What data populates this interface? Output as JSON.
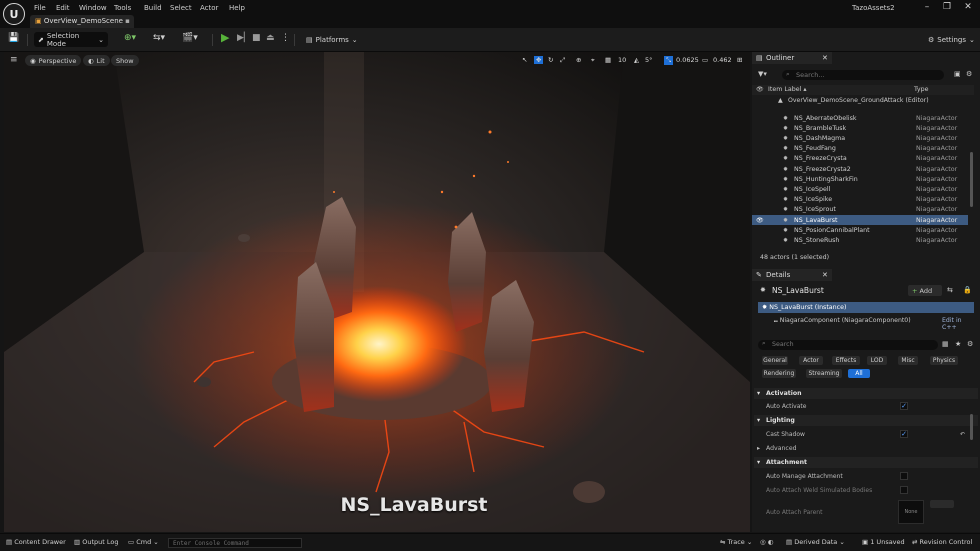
{
  "app": {
    "menu": [
      "File",
      "Edit",
      "Window",
      "Tools",
      "Build",
      "Select",
      "Actor",
      "Help"
    ],
    "document_tab": "OverView_DemoScene",
    "project_name": "TazoAssets2"
  },
  "toolbar": {
    "selection_mode": "Selection Mode",
    "platforms": "Platforms",
    "settings": "Settings"
  },
  "viewport": {
    "perspective": "Perspective",
    "lit": "Lit",
    "show": "Show",
    "grid_snap": "10",
    "rotation_snap": "5°",
    "scale_snap": "0.0625",
    "camera_speed": "0.462",
    "overlay_label": "NS_LavaBurst"
  },
  "outliner": {
    "tab": "Outliner",
    "search_placeholder": "Search...",
    "col_label": "Item Label ▴",
    "col_type": "Type",
    "level": "OverView_DemoScene_GroundAttack (Editor)",
    "rows": [
      {
        "name": "NS_AberrateObelisk",
        "type": "NiagaraActor"
      },
      {
        "name": "NS_BrambleTusk",
        "type": "NiagaraActor"
      },
      {
        "name": "NS_DashMagma",
        "type": "NiagaraActor"
      },
      {
        "name": "NS_FeudFang",
        "type": "NiagaraActor"
      },
      {
        "name": "NS_FreezeCrysta",
        "type": "NiagaraActor"
      },
      {
        "name": "NS_FreezeCrysta2",
        "type": "NiagaraActor"
      },
      {
        "name": "NS_HuntingSharkFin",
        "type": "NiagaraActor"
      },
      {
        "name": "NS_IceSpell",
        "type": "NiagaraActor"
      },
      {
        "name": "NS_IceSpike",
        "type": "NiagaraActor"
      },
      {
        "name": "NS_IceSprout",
        "type": "NiagaraActor"
      },
      {
        "name": "NS_LavaBurst",
        "type": "NiagaraActor"
      },
      {
        "name": "NS_PosionCannibalPlant",
        "type": "NiagaraActor"
      },
      {
        "name": "NS_StoneRush",
        "type": "NiagaraActor"
      }
    ],
    "selected_index": 10,
    "footer": "48 actors (1 selected)"
  },
  "details": {
    "tab": "Details",
    "actor_name": "NS_LavaBurst",
    "add": "Add",
    "instance": "NS_LavaBurst (Instance)",
    "component": "NiagaraComponent (NiagaraComponent0)",
    "edit_cpp": "Edit in C++",
    "search_placeholder": "Search",
    "categories_row1": [
      "General",
      "Actor",
      "Effects",
      "LOD",
      "Misc",
      "Physics"
    ],
    "categories_row2": [
      "Rendering",
      "Streaming",
      "All"
    ],
    "sections": {
      "activation": "Activation",
      "auto_activate": "Auto Activate",
      "lighting": "Lighting",
      "cast_shadow": "Cast Shadow",
      "advanced": "Advanced",
      "attachment": "Attachment",
      "auto_manage": "Auto Manage Attachment",
      "auto_weld": "Auto Attach Weld Simulated Bodies",
      "auto_parent": "Auto Attach Parent",
      "none": "None"
    }
  },
  "statusbar": {
    "content_drawer": "Content Drawer",
    "output_log": "Output Log",
    "cmd": "Cmd",
    "console_placeholder": "Enter Console Command",
    "trace": "Trace",
    "derived_data": "Derived Data",
    "unsaved": "1 Unsaved",
    "revision_control": "Revision Control"
  },
  "colors": {
    "selection": "#3d5b82",
    "accent": "#1e6fd6",
    "play": "#57b33a"
  }
}
